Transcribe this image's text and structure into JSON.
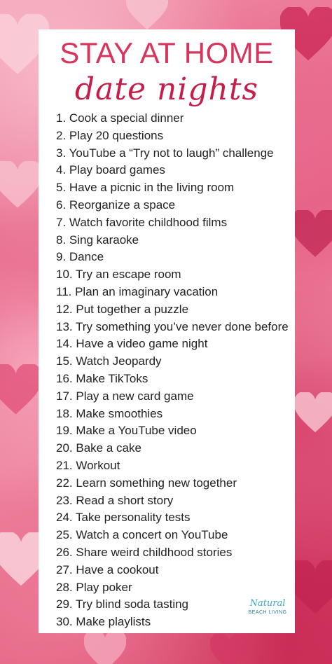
{
  "title": {
    "line1": "STAY AT HOME",
    "line2": "date nights"
  },
  "items": [
    "1. Cook a special dinner",
    "2. Play 20 questions",
    "3. YouTube a “Try not to laugh” challenge",
    "4. Play board games",
    "5. Have a picnic in the living room",
    "6. Reorganize a space",
    "7. Watch favorite childhood films",
    "8. Sing karaoke",
    "9. Dance",
    "10. Try an escape room",
    "11. Plan an imaginary vacation",
    "12. Put together a puzzle",
    "13. Try something you’ve never done before",
    "14. Have a video game night",
    "15. Watch Jeopardy",
    "16. Make TikToks",
    "17. Play a new card game",
    "18. Make smoothies",
    "19. Make a YouTube video",
    "20. Bake a cake",
    "21. Workout",
    "22. Learn something new together",
    "23. Read a short story",
    "24. Take personality tests",
    "25. Watch a concert on YouTube",
    "26. Share weird childhood stories",
    "27. Have a cookout",
    "28. Play poker",
    "29. Try blind soda tasting",
    "30. Make playlists"
  ],
  "brand": {
    "top": "Natural",
    "bottom": "BEACH LIVING"
  },
  "colors": {
    "title": "#d6365e",
    "script": "#c41e4a",
    "brand": "#3aa8c9"
  }
}
